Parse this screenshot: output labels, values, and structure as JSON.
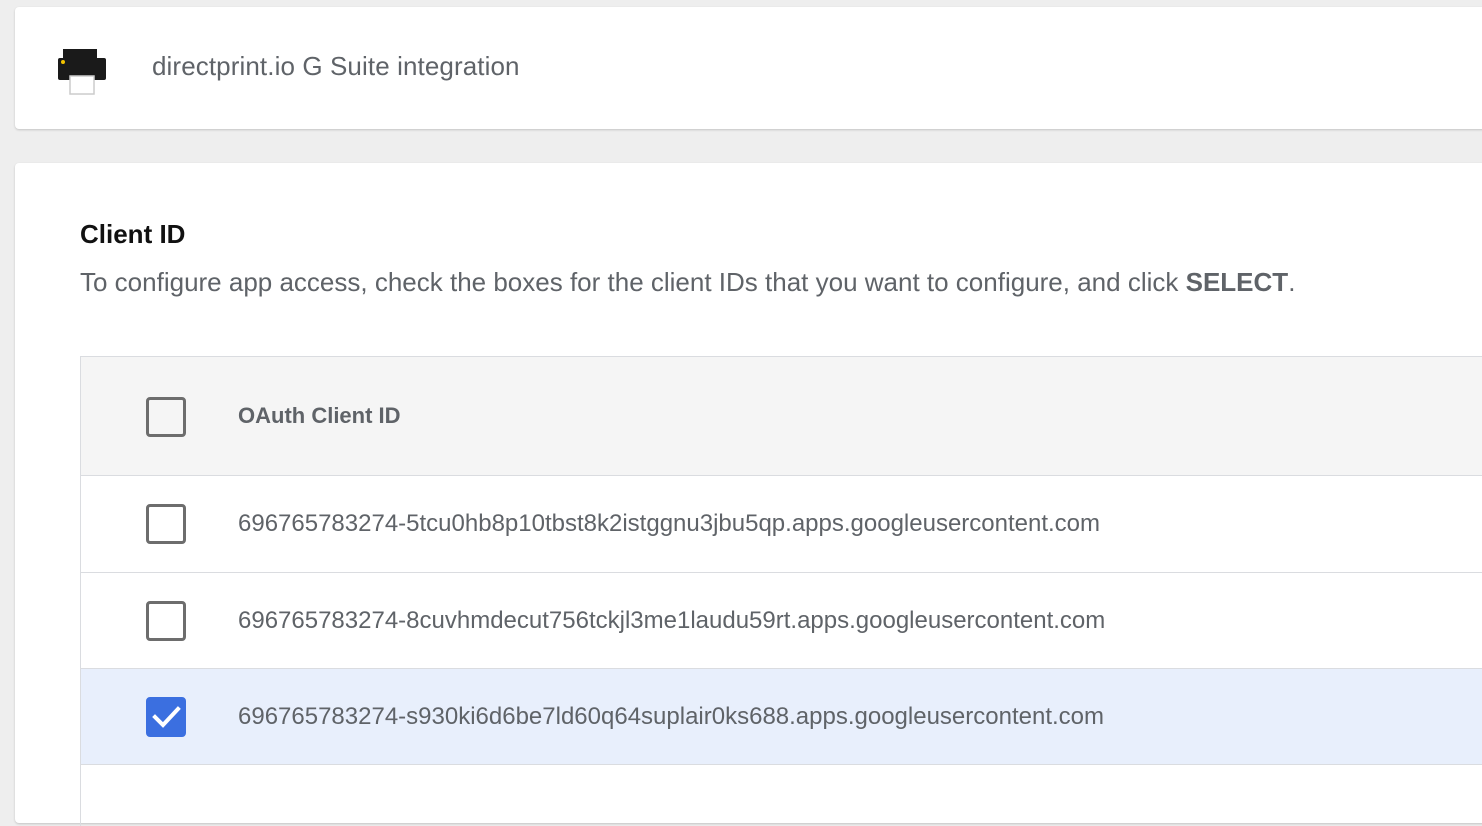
{
  "header": {
    "app_title": "directprint.io G Suite integration",
    "icon": "printer-icon"
  },
  "section": {
    "title": "Client ID",
    "description_prefix": "To configure app access, check the boxes for the client IDs that you want to configure, and click ",
    "description_action": "SELECT",
    "description_suffix": "."
  },
  "table": {
    "column_header": "OAuth Client ID",
    "rows": [
      {
        "client_id": "696765783274-5tcu0hb8p10tbst8k2istggnu3jbu5qp.apps.googleusercontent.com",
        "checked": false
      },
      {
        "client_id": "696765783274-8cuvhmdecut756tckjl3me1laudu59rt.apps.googleusercontent.com",
        "checked": false
      },
      {
        "client_id": "696765783274-s930ki6d6be7ld60q64suplair0ks688.apps.googleusercontent.com",
        "checked": true
      }
    ]
  },
  "colors": {
    "accent": "#3b6fe0",
    "selected_row": "#e8effc",
    "text_secondary": "#5f6368"
  }
}
